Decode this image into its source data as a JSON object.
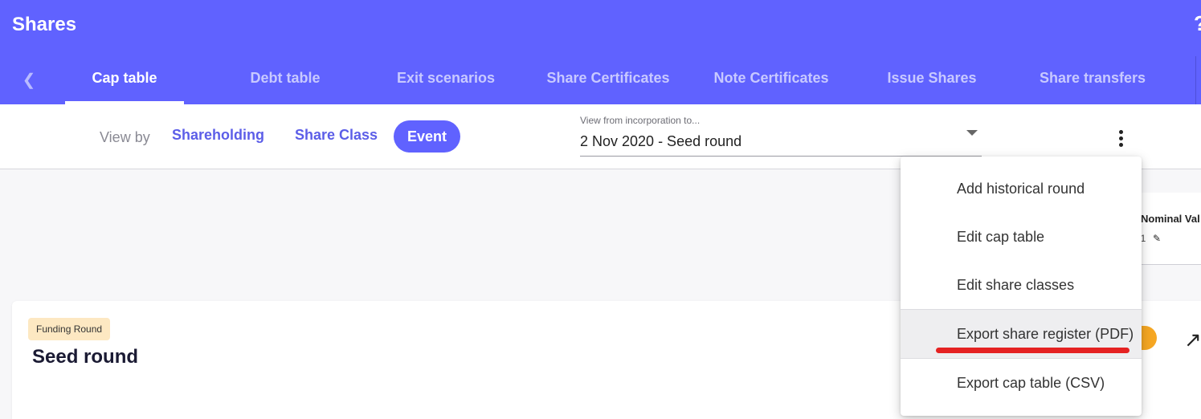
{
  "app": {
    "title": "Shares"
  },
  "tabs": [
    "Cap table",
    "Debt table",
    "Exit scenarios",
    "Share Certificates",
    "Note Certificates",
    "Issue Shares",
    "Share transfers"
  ],
  "view_by": {
    "label": "View by",
    "options": [
      "Shareholding",
      "Share Class",
      "Event"
    ],
    "selected": "Event"
  },
  "period_select": {
    "label": "View from incorporation to...",
    "value": "2 Nov 2020 - Seed round"
  },
  "background_table": {
    "header": "Nominal Val",
    "value_fragment": "01"
  },
  "round_card": {
    "tag": "Funding Round",
    "title": "Seed round"
  },
  "menu": {
    "items": [
      "Add historical round",
      "Edit cap table",
      "Edit share classes",
      "Export share register (PDF)",
      "Export cap table (CSV)"
    ],
    "highlighted": "Export share register (PDF)"
  },
  "colors": {
    "brand": "#6062ff",
    "menu_highlight": "#eeeef0",
    "annotation_red": "#e52222",
    "tag_bg": "#fde8c2",
    "badge_orange": "#f6a723"
  },
  "icons": {
    "prev": "chevron-left-icon",
    "help": "help-icon",
    "caret": "caret-down-icon",
    "more": "kebab-menu-icon",
    "edit": "pencil-icon",
    "open": "arrow-up-right-icon"
  }
}
